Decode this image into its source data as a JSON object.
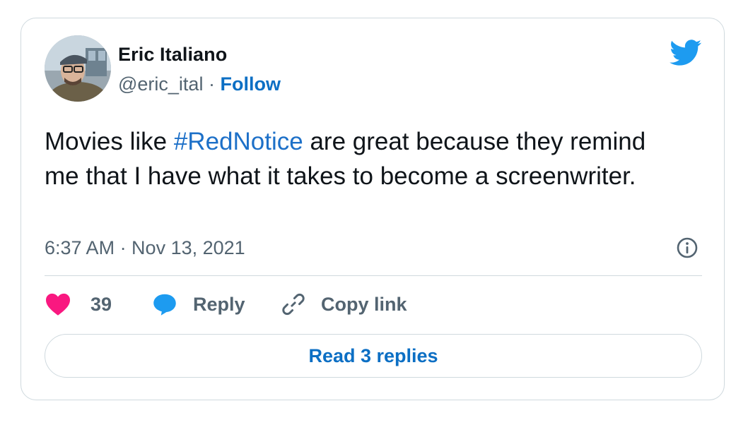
{
  "author": {
    "name": "Eric Italiano",
    "handle": "@eric_ital",
    "separator": "·",
    "follow_label": "Follow"
  },
  "tweet": {
    "text_before": "Movies like ",
    "hashtag": "#RedNotice",
    "text_after": " are great because they remind me that I have what it takes to become a screenwriter.",
    "timestamp": "6:37 AM · Nov 13, 2021"
  },
  "actions": {
    "like_count": "39",
    "reply_label": "Reply",
    "copy_link_label": "Copy link",
    "read_replies_label": "Read 3 replies"
  },
  "icons": {
    "brand": "twitter-bird-icon",
    "info": "info-icon",
    "like": "heart-icon",
    "reply": "speech-bubble-icon",
    "copy": "link-icon"
  },
  "colors": {
    "accent": "#1d9bf0",
    "link": "#0c6fc4",
    "like": "#f91880",
    "muted": "#536471",
    "border": "#cfd9de"
  }
}
